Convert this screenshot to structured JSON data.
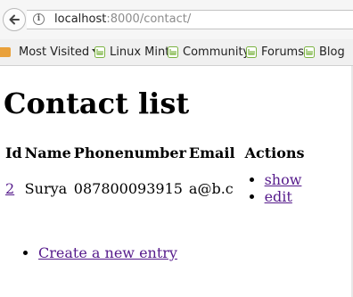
{
  "browser": {
    "url_host": "localhost",
    "url_rest": ":8000/contact/",
    "back_icon": "back-arrow-icon",
    "info_icon": "info-icon",
    "info_glyph": "i",
    "bookmarks": [
      {
        "label": "Most Visited",
        "icon": "folder-icon",
        "has_dropdown": true
      },
      {
        "label": "Linux Mint",
        "icon": "linux-mint-icon"
      },
      {
        "label": "Community",
        "icon": "linux-mint-icon"
      },
      {
        "label": "Forums",
        "icon": "linux-mint-icon"
      },
      {
        "label": "Blog",
        "icon": "linux-mint-icon"
      }
    ]
  },
  "page": {
    "title": "Contact list",
    "columns": [
      "Id",
      "Name",
      "Phonenumber",
      "Email",
      "Actions"
    ],
    "rows": [
      {
        "id": "2",
        "name": "Surya",
        "phone": "087800093915",
        "email": "a@b.c",
        "actions": [
          "show",
          "edit"
        ]
      }
    ],
    "create_link": "Create a new entry"
  },
  "colors": {
    "link": "#551a8b",
    "mint_green": "#7bb342",
    "folder": "#e9a13b"
  }
}
